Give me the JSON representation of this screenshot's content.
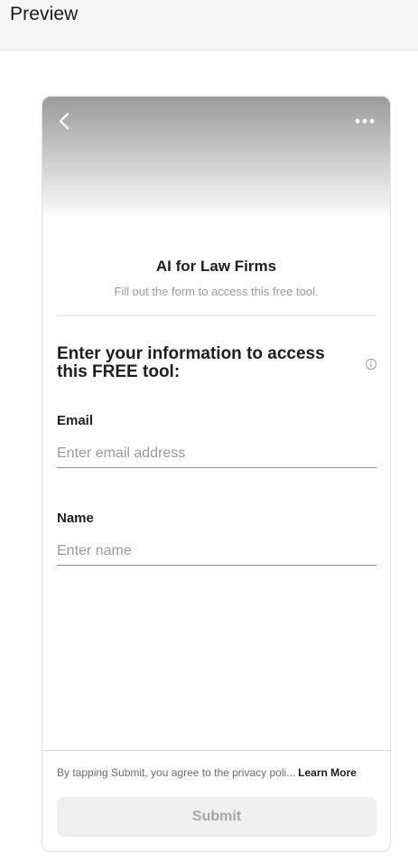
{
  "page": {
    "title": "Preview"
  },
  "card": {
    "header_gradient": [
      "#9b9b9b",
      "#ffffff"
    ],
    "back_icon": "chevron-left-icon",
    "more_icon": "more-horizontal-icon"
  },
  "form": {
    "title": "AI for Law Firms",
    "subtitle": "Fill out the form to access this free tool.",
    "heading": "Enter your information to access this FREE tool:",
    "info_icon": "info-icon",
    "fields": [
      {
        "label": "Email",
        "placeholder": "Enter email address",
        "value": ""
      },
      {
        "label": "Name",
        "placeholder": "Enter name",
        "value": ""
      }
    ]
  },
  "footer": {
    "disclaimer": "By tapping Submit, you agree to the privacy poli...",
    "learn_more": "Learn More",
    "submit_label": "Submit",
    "submit_bg": "#efefef",
    "submit_text_color": "#a8a8a8"
  }
}
